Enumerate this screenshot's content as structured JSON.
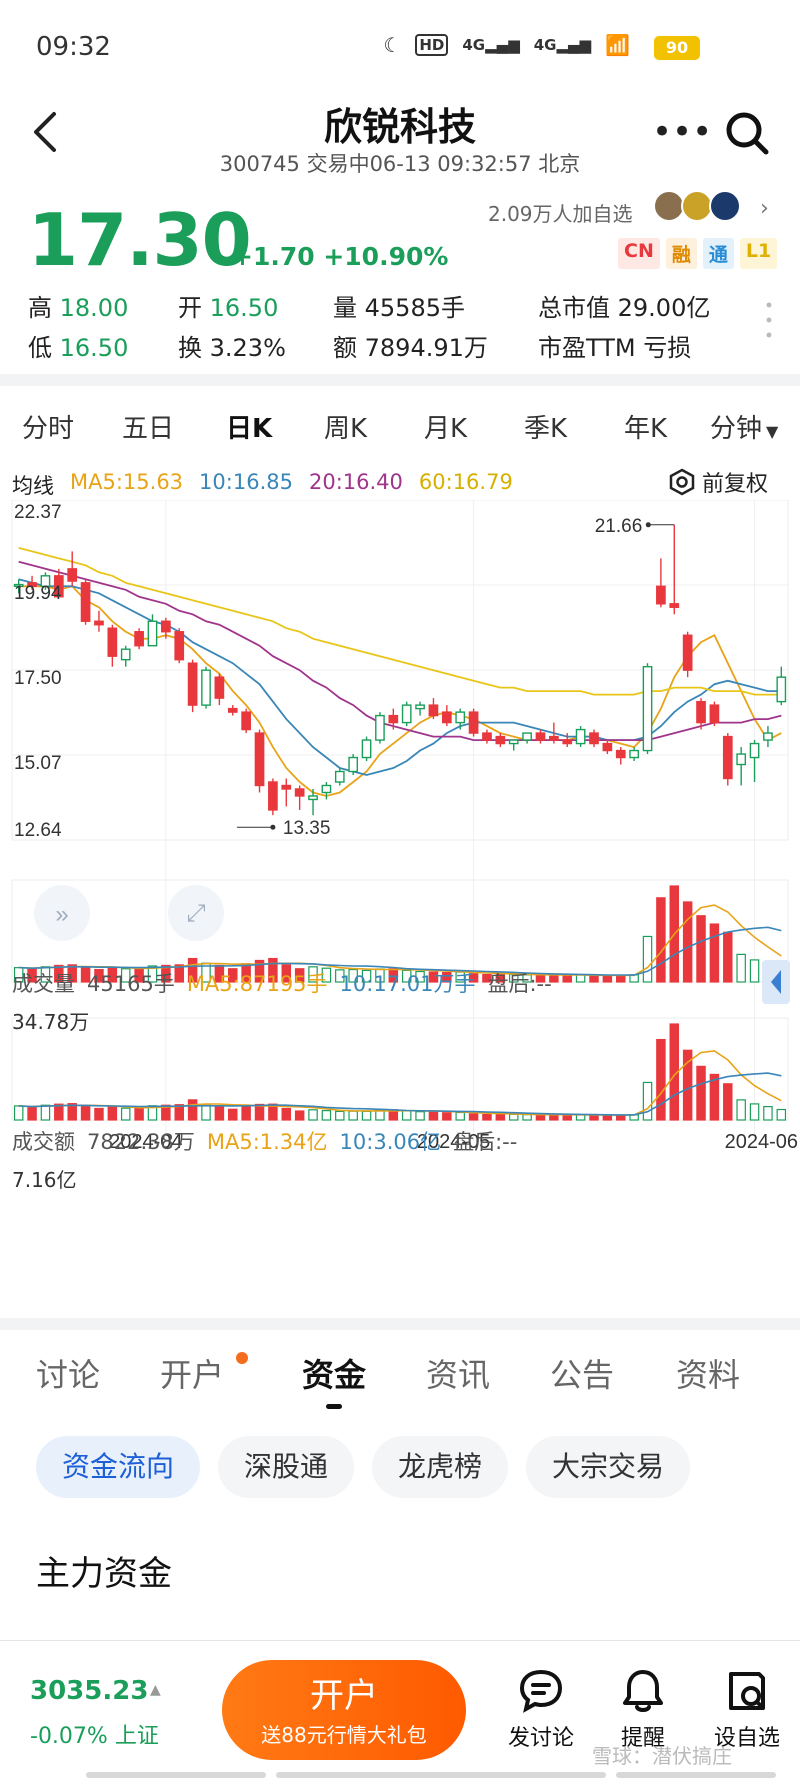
{
  "status": {
    "time": "09:32",
    "battery": "90",
    "net1": "HD",
    "net2": "4G",
    "net3": "4G"
  },
  "header": {
    "title": "欣锐科技",
    "subtitle": "300745 交易中06-13 09:32:57 北京"
  },
  "quote": {
    "price": "17.30",
    "change": "+1.70 +10.90%",
    "followers": "2.09万人加自选",
    "tags": [
      "CN",
      "融",
      "通",
      "L1"
    ],
    "stats": [
      [
        {
          "k": "高",
          "v": "18.00",
          "green": true
        },
        {
          "k": "开",
          "v": "16.50",
          "green": true
        },
        {
          "k": "量",
          "v": "45585手"
        },
        {
          "k": "总市值",
          "v": "29.00亿"
        }
      ],
      [
        {
          "k": "低",
          "v": "16.50",
          "green": true
        },
        {
          "k": "换",
          "v": "3.23%"
        },
        {
          "k": "额",
          "v": "7894.91万"
        },
        {
          "k": "市盈TTM",
          "v": "亏损"
        }
      ]
    ]
  },
  "period_tabs": [
    "分时",
    "五日",
    "日K",
    "周K",
    "月K",
    "季K",
    "年K",
    "分钟"
  ],
  "active_period": "日K",
  "ma_line": {
    "label": "均线",
    "ma5": "MA5:15.63",
    "ma10": "10:16.85",
    "ma20": "20:16.40",
    "ma60": "60:16.79",
    "adjust": "前复权"
  },
  "colors": {
    "up": "#e8383d",
    "down": "#1a9e5a",
    "ma5": "#e8a317",
    "ma10": "#3a86b8",
    "ma20": "#a0348c",
    "ma60": "#e8c517"
  },
  "chart_data": [
    {
      "type": "candlestick",
      "title": "",
      "y_ticks": [
        "22.37",
        "19.94",
        "17.50",
        "15.07",
        "12.64"
      ],
      "ylim": [
        12.64,
        22.37
      ],
      "x_ticks": [
        "2024-04",
        "2024-05",
        "2024-06"
      ],
      "annotations": [
        {
          "label": "21.66",
          "kind": "high"
        },
        {
          "label": "13.35",
          "kind": "low"
        }
      ],
      "candles": [
        [
          19.9,
          20.1,
          19.7,
          19.95
        ],
        [
          20.0,
          20.2,
          19.8,
          19.9
        ],
        [
          19.9,
          20.3,
          19.8,
          20.2
        ],
        [
          20.2,
          20.4,
          19.6,
          19.6
        ],
        [
          20.4,
          20.9,
          19.9,
          20.05
        ],
        [
          20.0,
          20.1,
          18.8,
          18.9
        ],
        [
          18.9,
          19.2,
          18.6,
          18.8
        ],
        [
          18.7,
          18.8,
          17.6,
          17.9
        ],
        [
          17.8,
          18.2,
          17.6,
          18.1
        ],
        [
          18.6,
          18.7,
          18.1,
          18.2
        ],
        [
          18.2,
          19.1,
          18.2,
          18.9
        ],
        [
          18.9,
          19.0,
          18.4,
          18.6
        ],
        [
          18.6,
          18.7,
          17.7,
          17.8
        ],
        [
          17.7,
          17.8,
          16.3,
          16.5
        ],
        [
          16.5,
          17.6,
          16.4,
          17.5
        ],
        [
          17.3,
          17.4,
          16.5,
          16.7
        ],
        [
          16.4,
          16.5,
          16.2,
          16.3
        ],
        [
          16.3,
          16.4,
          15.7,
          15.8
        ],
        [
          15.7,
          15.8,
          14.0,
          14.2
        ],
        [
          14.3,
          14.4,
          13.35,
          13.5
        ],
        [
          14.2,
          14.4,
          13.6,
          14.1
        ],
        [
          14.1,
          14.2,
          13.5,
          13.9
        ],
        [
          13.8,
          14.1,
          13.35,
          13.9
        ],
        [
          14.0,
          14.3,
          13.8,
          14.2
        ],
        [
          14.3,
          14.7,
          14.2,
          14.6
        ],
        [
          14.6,
          15.1,
          14.5,
          15.0
        ],
        [
          15.0,
          15.6,
          14.9,
          15.5
        ],
        [
          15.5,
          16.3,
          15.4,
          16.2
        ],
        [
          16.2,
          16.4,
          15.8,
          16.0
        ],
        [
          16.0,
          16.6,
          15.9,
          16.5
        ],
        [
          16.4,
          16.6,
          16.2,
          16.5
        ],
        [
          16.5,
          16.7,
          16.1,
          16.2
        ],
        [
          16.3,
          16.5,
          15.9,
          16.0
        ],
        [
          16.0,
          16.4,
          15.8,
          16.3
        ],
        [
          16.3,
          16.4,
          15.6,
          15.7
        ],
        [
          15.7,
          15.8,
          15.4,
          15.5
        ],
        [
          15.6,
          15.7,
          15.3,
          15.4
        ],
        [
          15.4,
          15.5,
          15.2,
          15.5
        ],
        [
          15.5,
          15.7,
          15.4,
          15.7
        ],
        [
          15.7,
          15.8,
          15.4,
          15.5
        ],
        [
          15.6,
          16.0,
          15.4,
          15.5
        ],
        [
          15.5,
          15.7,
          15.3,
          15.4
        ],
        [
          15.4,
          15.9,
          15.3,
          15.8
        ],
        [
          15.7,
          15.8,
          15.3,
          15.4
        ],
        [
          15.4,
          15.5,
          15.1,
          15.2
        ],
        [
          15.2,
          15.3,
          14.8,
          15.0
        ],
        [
          15.0,
          15.3,
          14.9,
          15.2
        ],
        [
          15.2,
          17.7,
          15.1,
          17.6
        ],
        [
          19.9,
          20.7,
          19.3,
          19.4
        ],
        [
          19.4,
          21.66,
          19.1,
          19.3
        ],
        [
          18.5,
          18.6,
          17.3,
          17.5
        ],
        [
          16.6,
          16.7,
          15.8,
          16.0
        ],
        [
          16.5,
          16.6,
          15.9,
          16.0
        ],
        [
          15.6,
          15.7,
          14.2,
          14.4
        ],
        [
          14.8,
          15.3,
          14.2,
          15.1
        ],
        [
          15.0,
          15.5,
          14.3,
          15.4
        ],
        [
          15.5,
          15.9,
          15.3,
          15.7
        ],
        [
          16.6,
          17.6,
          16.5,
          17.3
        ]
      ],
      "ma": {
        "MA5": [
          19.9,
          19.9,
          19.9,
          19.8,
          19.9,
          19.5,
          19.3,
          18.9,
          18.6,
          18.4,
          18.4,
          18.5,
          18.4,
          18.1,
          17.7,
          17.4,
          16.9,
          16.5,
          16.0,
          15.3,
          14.7,
          14.3,
          14.0,
          13.9,
          14.0,
          14.3,
          14.6,
          15.1,
          15.4,
          15.7,
          16.0,
          16.2,
          16.3,
          16.2,
          16.1,
          15.9,
          15.7,
          15.6,
          15.5,
          15.5,
          15.5,
          15.5,
          15.6,
          15.6,
          15.5,
          15.4,
          15.3,
          15.7,
          16.4,
          17.3,
          17.9,
          18.3,
          18.5,
          17.7,
          16.9,
          16.1,
          15.5,
          15.7
        ],
        "MA10": [
          20.1,
          20.0,
          19.9,
          19.9,
          19.9,
          19.8,
          19.7,
          19.5,
          19.3,
          19.1,
          18.9,
          18.8,
          18.6,
          18.3,
          18.1,
          17.9,
          17.7,
          17.4,
          17.1,
          16.6,
          16.1,
          15.7,
          15.3,
          15.0,
          14.7,
          14.6,
          14.5,
          14.6,
          14.7,
          14.9,
          15.2,
          15.4,
          15.7,
          15.9,
          16.0,
          16.0,
          16.0,
          16.0,
          15.9,
          15.8,
          15.7,
          15.6,
          15.6,
          15.6,
          15.5,
          15.5,
          15.5,
          15.6,
          15.9,
          16.3,
          16.6,
          16.8,
          17.1,
          17.2,
          17.1,
          17.0,
          16.9,
          16.9
        ],
        "MA20": [
          20.6,
          20.5,
          20.4,
          20.3,
          20.2,
          20.1,
          20.0,
          19.9,
          19.8,
          19.6,
          19.5,
          19.4,
          19.2,
          19.1,
          18.9,
          18.8,
          18.6,
          18.4,
          18.2,
          17.9,
          17.7,
          17.5,
          17.2,
          17.0,
          16.7,
          16.5,
          16.2,
          16.0,
          15.9,
          15.8,
          15.7,
          15.6,
          15.6,
          15.6,
          15.5,
          15.5,
          15.5,
          15.5,
          15.5,
          15.5,
          15.5,
          15.5,
          15.5,
          15.5,
          15.5,
          15.5,
          15.5,
          15.5,
          15.6,
          15.7,
          15.8,
          15.9,
          16.0,
          16.0,
          16.0,
          16.1,
          16.1,
          16.2
        ],
        "MA60": [
          21.0,
          20.9,
          20.8,
          20.7,
          20.6,
          20.5,
          20.3,
          20.2,
          20.0,
          19.9,
          19.8,
          19.7,
          19.6,
          19.5,
          19.4,
          19.3,
          19.2,
          19.1,
          19.0,
          18.9,
          18.7,
          18.6,
          18.4,
          18.3,
          18.2,
          18.1,
          18.0,
          17.9,
          17.8,
          17.7,
          17.6,
          17.5,
          17.4,
          17.3,
          17.2,
          17.1,
          17.0,
          17.0,
          16.9,
          16.9,
          16.9,
          16.9,
          16.9,
          16.8,
          16.8,
          16.8,
          16.8,
          16.9,
          16.9,
          17.0,
          17.0,
          17.0,
          16.9,
          16.9,
          16.9,
          16.8,
          16.8,
          16.8
        ]
      }
    },
    {
      "type": "bar",
      "title": "成交量",
      "y_ticks": [
        "34.78万"
      ],
      "ylim": [
        0,
        347800
      ],
      "legend": [
        "45165手",
        "MA5:87195手",
        "10:17.01万手",
        "盘后:--"
      ],
      "values": [
        52000,
        48000,
        55000,
        60000,
        62000,
        54000,
        45000,
        52000,
        48000,
        47000,
        58000,
        60000,
        62000,
        85000,
        68000,
        60000,
        48000,
        66000,
        78000,
        85000,
        62000,
        48000,
        55000,
        50000,
        44000,
        45000,
        42000,
        47000,
        48000,
        42000,
        38000,
        36000,
        34000,
        36000,
        30000,
        27000,
        28000,
        28000,
        26000,
        24000,
        24000,
        26000,
        26000,
        24000,
        22000,
        24000,
        26000,
        165000,
        305000,
        347800,
        290000,
        240000,
        210000,
        180000,
        100000,
        80000,
        65000,
        45165
      ]
    },
    {
      "type": "bar",
      "title": "成交额",
      "y_ticks": [
        "7.16亿"
      ],
      "ylim": [
        0,
        716000000
      ],
      "legend": [
        "7822.38万",
        "MA5:1.34亿",
        "10:3.06亿",
        "盘后:--"
      ],
      "values": [
        105000000,
        95000000,
        110000000,
        118000000,
        122000000,
        104000000,
        86000000,
        96000000,
        88000000,
        86000000,
        106000000,
        110000000,
        114000000,
        150000000,
        118000000,
        104000000,
        80000000,
        106000000,
        116000000,
        118000000,
        86000000,
        67000000,
        76000000,
        70000000,
        64000000,
        66000000,
        64000000,
        74000000,
        76000000,
        68000000,
        62000000,
        58000000,
        54000000,
        56000000,
        46000000,
        41000000,
        42000000,
        42000000,
        40000000,
        37000000,
        37000000,
        40000000,
        40000000,
        37000000,
        33000000,
        36000000,
        39000000,
        280000000,
        600000000,
        716000000,
        520000000,
        400000000,
        340000000,
        270000000,
        150000000,
        120000000,
        100000000,
        78223800
      ]
    }
  ],
  "bottom_tabs": [
    "讨论",
    "开户",
    "资金",
    "资讯",
    "公告",
    "资料"
  ],
  "active_bottom_tab": "资金",
  "chips": [
    "资金流向",
    "深股通",
    "龙虎榜",
    "大宗交易"
  ],
  "active_chip": "资金流向",
  "section_title": "主力资金",
  "bottom_bar": {
    "index_value": "3035.23",
    "index_change": "-0.07% 上证",
    "cta_title": "开户",
    "cta_sub": "送88元行情大礼包",
    "actions": [
      {
        "label": "发讨论",
        "icon": "chat-icon"
      },
      {
        "label": "提醒",
        "icon": "bell-icon"
      },
      {
        "label": "设自选",
        "icon": "add-watchlist-icon"
      }
    ],
    "watermark": "雪球：潜伏搞庄"
  }
}
